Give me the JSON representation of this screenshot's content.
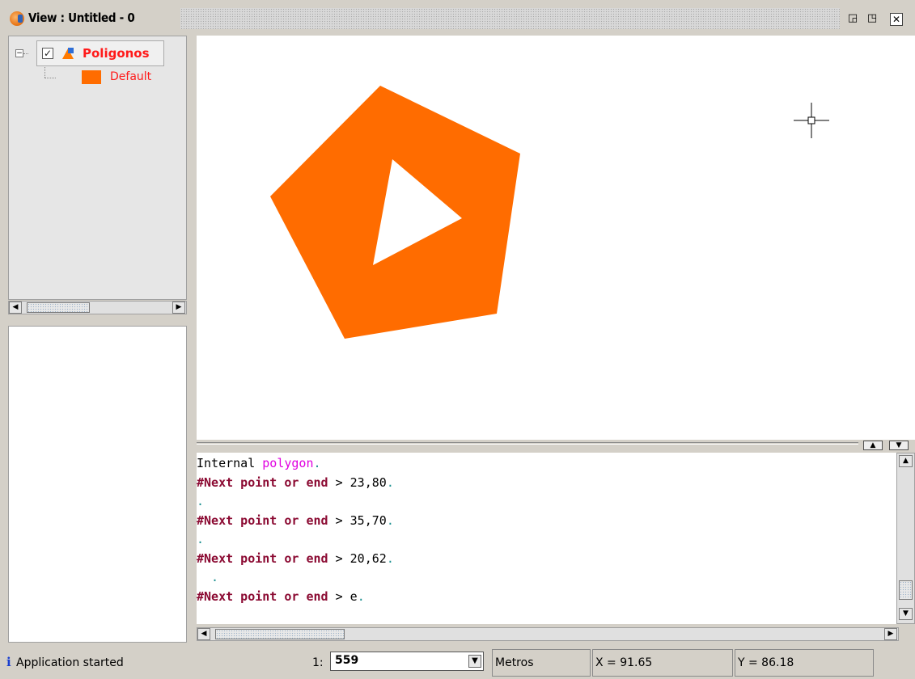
{
  "window": {
    "title": "View : Untitled - 0",
    "buttons": {
      "minimize": "◲",
      "restore": "◳",
      "close": "✕"
    }
  },
  "toc": {
    "layer_name": "Poligonos",
    "checkbox": "✓",
    "expander": "−",
    "legend_label": "Default",
    "colors": {
      "layer_text": "#ff1a1a",
      "swatch": "#ff6c00"
    }
  },
  "map": {
    "fill_color": "#ff6c00",
    "outer_polygon": [
      [
        470,
        106
      ],
      [
        643,
        190
      ],
      [
        614,
        388
      ],
      [
        426,
        419
      ],
      [
        334,
        243
      ]
    ],
    "inner_hole": [
      [
        485,
        197
      ],
      [
        571,
        270
      ],
      [
        461,
        328
      ]
    ],
    "cursor_icon": "crosshair-icon"
  },
  "console": {
    "lines": [
      {
        "parts": [
          {
            "t": "Internal ",
            "c": "normal"
          },
          {
            "t": "polygon",
            "c": "magenta"
          },
          {
            "t": ".",
            "c": "teal"
          }
        ]
      },
      {
        "parts": [
          {
            "t": "#Next point or end",
            "c": "kw"
          },
          {
            "t": " > 23,80",
            "c": "normal"
          },
          {
            "t": ".",
            "c": "teal"
          }
        ]
      },
      {
        "parts": [
          {
            "t": ".",
            "c": "teal"
          }
        ]
      },
      {
        "parts": [
          {
            "t": "#Next point or end",
            "c": "kw"
          },
          {
            "t": " > 35,70",
            "c": "normal"
          },
          {
            "t": ".",
            "c": "teal"
          }
        ]
      },
      {
        "parts": [
          {
            "t": ".",
            "c": "teal"
          }
        ]
      },
      {
        "parts": [
          {
            "t": "#Next point or end",
            "c": "kw"
          },
          {
            "t": " > 20,62",
            "c": "normal"
          },
          {
            "t": ".",
            "c": "teal"
          }
        ]
      },
      {
        "parts": [
          {
            "t": "  .",
            "c": "teal"
          }
        ]
      },
      {
        "parts": [
          {
            "t": "#Next point or end",
            "c": "kw"
          },
          {
            "t": " > e",
            "c": "normal"
          },
          {
            "t": ".",
            "c": "teal"
          }
        ]
      }
    ]
  },
  "status": {
    "info_icon": "i",
    "message": "Application started",
    "scale_prefix": "1:",
    "scale_value": "559",
    "units": "Metros",
    "x_coord": "X = 91.65",
    "y_coord": "Y = 86.18"
  }
}
